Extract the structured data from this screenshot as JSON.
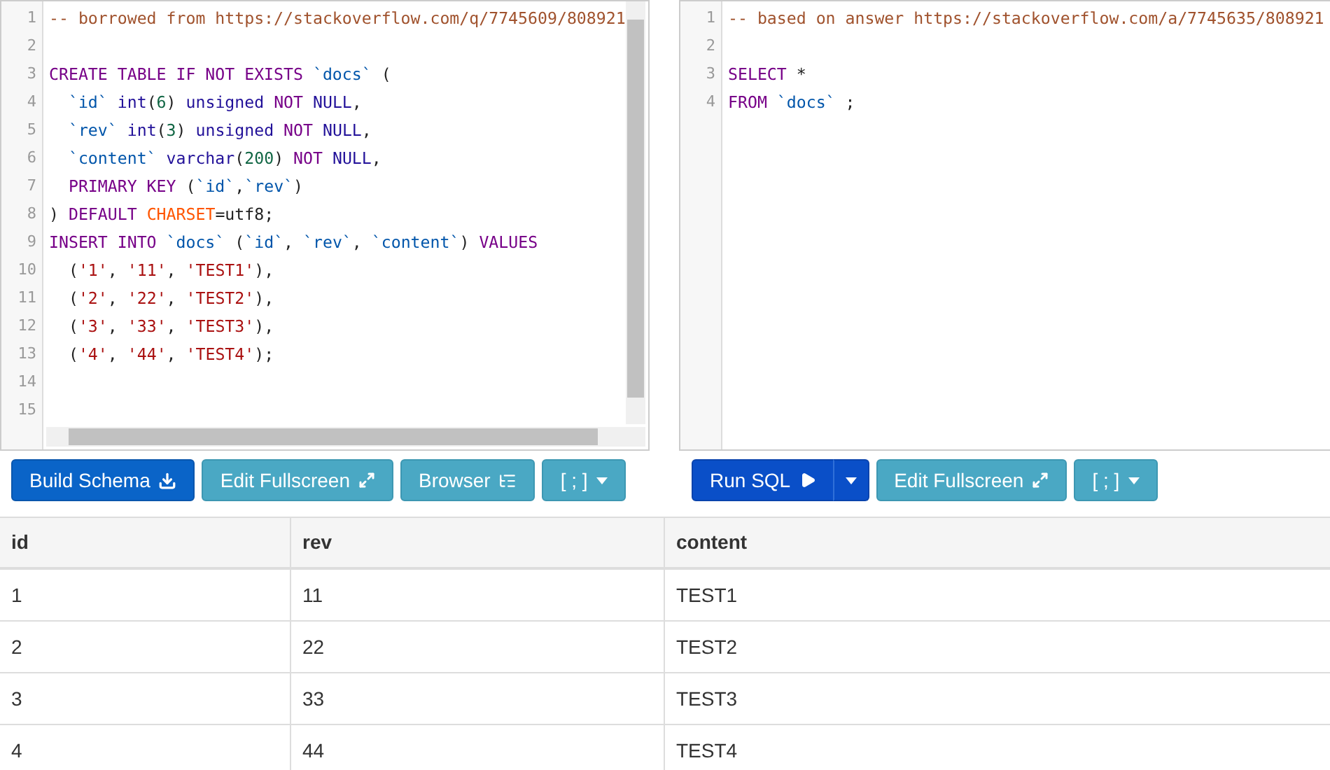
{
  "editors": [
    {
      "scrollbars": true,
      "lines": [
        {
          "number": "1",
          "tokens": [
            {
              "kind": "comment",
              "text": "-- borrowed from https://stackoverflow.com/q/7745609/808921"
            }
          ]
        },
        {
          "number": "2"
        },
        {
          "number": "3",
          "tokens": [
            {
              "kind": "keyword",
              "text": "CREATE TABLE IF NOT EXISTS"
            },
            {
              "kind": "name",
              "text": " `docs`"
            },
            {
              "kind": "plain",
              "text": " ("
            }
          ]
        },
        {
          "number": "4",
          "tokens": [
            {
              "kind": "name",
              "text": "  `id`"
            },
            {
              "kind": "type",
              "text": " int"
            },
            {
              "kind": "plain",
              "text": "("
            },
            {
              "kind": "number",
              "text": "6"
            },
            {
              "kind": "plain",
              "text": ") "
            },
            {
              "kind": "type",
              "text": "unsigned"
            },
            {
              "kind": "keyword",
              "text": " NOT"
            },
            {
              "kind": "type",
              "text": " NULL"
            },
            {
              "kind": "plain",
              "text": ","
            }
          ]
        },
        {
          "number": "5",
          "tokens": [
            {
              "kind": "name",
              "text": "  `rev`"
            },
            {
              "kind": "type",
              "text": " int"
            },
            {
              "kind": "plain",
              "text": "("
            },
            {
              "kind": "number",
              "text": "3"
            },
            {
              "kind": "plain",
              "text": ") "
            },
            {
              "kind": "type",
              "text": "unsigned"
            },
            {
              "kind": "keyword",
              "text": " NOT"
            },
            {
              "kind": "type",
              "text": " NULL"
            },
            {
              "kind": "plain",
              "text": ","
            }
          ]
        },
        {
          "number": "6",
          "tokens": [
            {
              "kind": "name",
              "text": "  `content`"
            },
            {
              "kind": "type",
              "text": " varchar"
            },
            {
              "kind": "plain",
              "text": "("
            },
            {
              "kind": "number",
              "text": "200"
            },
            {
              "kind": "plain",
              "text": ") "
            },
            {
              "kind": "keyword",
              "text": "NOT"
            },
            {
              "kind": "type",
              "text": " NULL"
            },
            {
              "kind": "plain",
              "text": ","
            }
          ]
        },
        {
          "number": "7",
          "tokens": [
            {
              "kind": "keyword",
              "text": "  PRIMARY KEY"
            },
            {
              "kind": "plain",
              "text": " ("
            },
            {
              "kind": "name",
              "text": "`id`"
            },
            {
              "kind": "plain",
              "text": ","
            },
            {
              "kind": "name",
              "text": "`rev`"
            },
            {
              "kind": "plain",
              "text": ")"
            }
          ]
        },
        {
          "number": "8",
          "tokens": [
            {
              "kind": "plain",
              "text": ") "
            },
            {
              "kind": "keyword",
              "text": "DEFAULT"
            },
            {
              "kind": "builtin",
              "text": " CHARSET"
            },
            {
              "kind": "plain",
              "text": "=utf8;"
            }
          ]
        },
        {
          "number": "9",
          "tokens": [
            {
              "kind": "keyword",
              "text": "INSERT INTO"
            },
            {
              "kind": "name",
              "text": " `docs`"
            },
            {
              "kind": "plain",
              "text": " ("
            },
            {
              "kind": "name",
              "text": "`id`"
            },
            {
              "kind": "plain",
              "text": ", "
            },
            {
              "kind": "name",
              "text": "`rev`"
            },
            {
              "kind": "plain",
              "text": ", "
            },
            {
              "kind": "name",
              "text": "`content`"
            },
            {
              "kind": "plain",
              "text": ") "
            },
            {
              "kind": "keyword",
              "text": "VALUES"
            }
          ]
        },
        {
          "number": "10",
          "tokens": [
            {
              "kind": "plain",
              "text": "  ("
            },
            {
              "kind": "string",
              "text": "'1'"
            },
            {
              "kind": "plain",
              "text": ", "
            },
            {
              "kind": "string",
              "text": "'11'"
            },
            {
              "kind": "plain",
              "text": ", "
            },
            {
              "kind": "string",
              "text": "'TEST1'"
            },
            {
              "kind": "plain",
              "text": "),"
            }
          ]
        },
        {
          "number": "11",
          "tokens": [
            {
              "kind": "plain",
              "text": "  ("
            },
            {
              "kind": "string",
              "text": "'2'"
            },
            {
              "kind": "plain",
              "text": ", "
            },
            {
              "kind": "string",
              "text": "'22'"
            },
            {
              "kind": "plain",
              "text": ", "
            },
            {
              "kind": "string",
              "text": "'TEST2'"
            },
            {
              "kind": "plain",
              "text": "),"
            }
          ]
        },
        {
          "number": "12",
          "tokens": [
            {
              "kind": "plain",
              "text": "  ("
            },
            {
              "kind": "string",
              "text": "'3'"
            },
            {
              "kind": "plain",
              "text": ", "
            },
            {
              "kind": "string",
              "text": "'33'"
            },
            {
              "kind": "plain",
              "text": ", "
            },
            {
              "kind": "string",
              "text": "'TEST3'"
            },
            {
              "kind": "plain",
              "text": "),"
            }
          ]
        },
        {
          "number": "13",
          "tokens": [
            {
              "kind": "plain",
              "text": "  ("
            },
            {
              "kind": "string",
              "text": "'4'"
            },
            {
              "kind": "plain",
              "text": ", "
            },
            {
              "kind": "string",
              "text": "'44'"
            },
            {
              "kind": "plain",
              "text": ", "
            },
            {
              "kind": "string",
              "text": "'TEST4'"
            },
            {
              "kind": "plain",
              "text": ");"
            }
          ]
        },
        {
          "number": "14"
        },
        {
          "number": "15"
        }
      ],
      "buttons": [
        {
          "kind": "build",
          "label": "Build Schema"
        },
        {
          "kind": "fullscreen",
          "label": "Edit Fullscreen"
        },
        {
          "kind": "browser",
          "label": "Browser"
        },
        {
          "kind": "delimiter",
          "label": "[ ; ]"
        }
      ]
    },
    {
      "scrollbars": false,
      "lines": [
        {
          "number": "1",
          "tokens": [
            {
              "kind": "comment",
              "text": "-- based on answer https://stackoverflow.com/a/7745635/808921"
            }
          ]
        },
        {
          "number": "2"
        },
        {
          "number": "3",
          "tokens": [
            {
              "kind": "keyword",
              "text": "SELECT"
            },
            {
              "kind": "plain",
              "text": " *"
            }
          ]
        },
        {
          "number": "4",
          "tokens": [
            {
              "kind": "keyword",
              "text": "FROM"
            },
            {
              "kind": "name",
              "text": " `docs`"
            },
            {
              "kind": "plain",
              "text": " ;"
            }
          ]
        }
      ],
      "buttons": [
        {
          "kind": "run",
          "label": "Run SQL"
        },
        {
          "kind": "split"
        },
        {
          "kind": "fullscreen",
          "label": "Edit Fullscreen"
        },
        {
          "kind": "delimiter",
          "label": "[ ; ]"
        }
      ]
    }
  ],
  "results": {
    "columns": [
      "id",
      "rev",
      "content"
    ],
    "rows": [
      [
        "1",
        "11",
        "TEST1"
      ],
      [
        "2",
        "22",
        "TEST2"
      ],
      [
        "3",
        "33",
        "TEST3"
      ],
      [
        "4",
        "44",
        "TEST4"
      ]
    ]
  }
}
